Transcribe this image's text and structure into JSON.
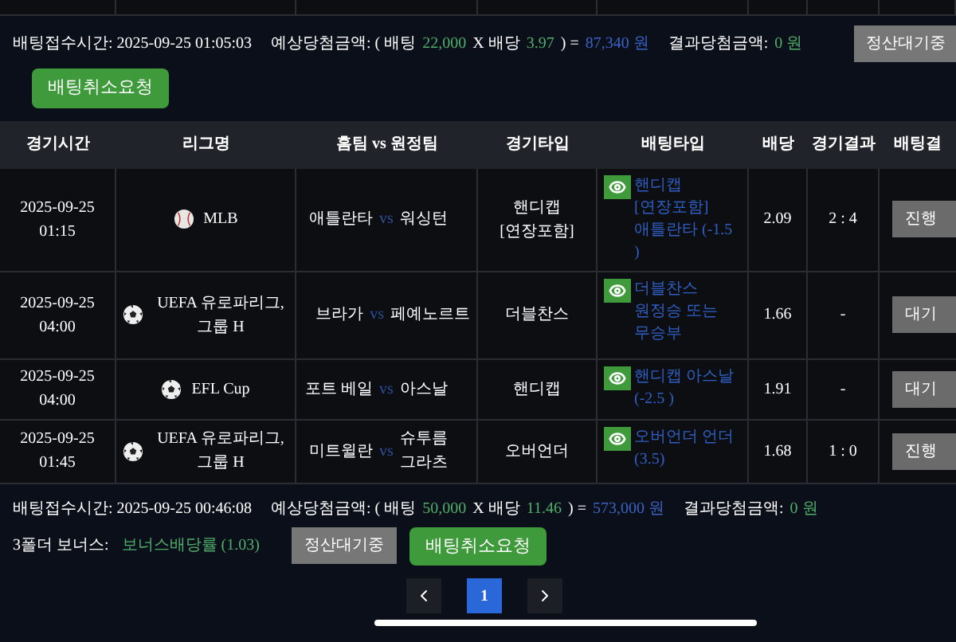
{
  "bets": [
    {
      "received_label": "배팅접수시간:",
      "received_time": "2025-09-25 01:05:03",
      "expected_label": "예상당첨금액:",
      "stake_label": "( 배팅",
      "stake": "22,000",
      "odds_label": "X 배당",
      "total_odds": "3.97",
      "equals": ") =",
      "payout": "87,340 원",
      "result_label": "결과당첨금액:",
      "result": "0 원",
      "status_button": "정산대기중",
      "cancel_button": "배팅취소요청"
    }
  ],
  "table": {
    "columns": [
      "경기시간",
      "리그명",
      "홈팀 vs 원정팀",
      "경기타입",
      "배팅타입",
      "배당",
      "경기결과",
      "배팅결"
    ],
    "rows": [
      {
        "date": "2025-09-25",
        "time": "01:15",
        "league": {
          "kind": "baseball",
          "name": "MLB"
        },
        "home": "애틀란타",
        "vs": "vs",
        "away": "워싱턴",
        "game_type": "핸디캡 [연장포함]",
        "bet_type": "핸디캡 [연장포함] 애틀란타 (-1.5 )",
        "odds": "2.09",
        "score": "2 : 4",
        "status": "진행"
      },
      {
        "date": "2025-09-25",
        "time": "04:00",
        "league": {
          "kind": "soccer",
          "name": "UEFA 유로파리그, 그룹 H"
        },
        "home": "브라가",
        "vs": "vs",
        "away": "페예노르트",
        "game_type": "더블찬스",
        "bet_type": "더블찬스 원정승 또는 무승부",
        "odds": "1.66",
        "score": "-",
        "status": "대기"
      },
      {
        "date": "2025-09-25",
        "time": "04:00",
        "league": {
          "kind": "soccer",
          "name": "EFL Cup"
        },
        "home": "포트 베일",
        "vs": "vs",
        "away": "아스날",
        "game_type": "핸디캡",
        "bet_type": "핸디캡 아스날 (-2.5 )",
        "odds": "1.91",
        "score": "-",
        "status": "대기"
      },
      {
        "date": "2025-09-25",
        "time": "01:45",
        "league": {
          "kind": "soccer",
          "name": "UEFA 유로파리그, 그룹 H"
        },
        "home": "미트윌란",
        "vs": "vs",
        "away": "슈투름 그라츠",
        "game_type": "오버언더",
        "bet_type": "오버언더 언더 (3.5)",
        "odds": "1.68",
        "score": "1 : 0",
        "status": "진행"
      }
    ]
  },
  "summary": {
    "received_label": "배팅접수시간:",
    "received_time": "2025-09-25 00:46:08",
    "expected_label": "예상당첨금액:",
    "stake_label": "( 배팅",
    "stake": "50,000",
    "odds_label": "X 배당",
    "total_odds": "11.46",
    "equals": ") =",
    "payout": "573,000 원",
    "result_label": "결과당첨금액:",
    "result": "0 원",
    "bonus_label": "3폴더 보너스:",
    "bonus": "보너스배당률 (1.03)",
    "status_button": "정산대기중",
    "cancel_button": "배팅취소요청"
  },
  "pagination": {
    "pages": [
      {
        "label": "1",
        "selected": true
      }
    ]
  }
}
